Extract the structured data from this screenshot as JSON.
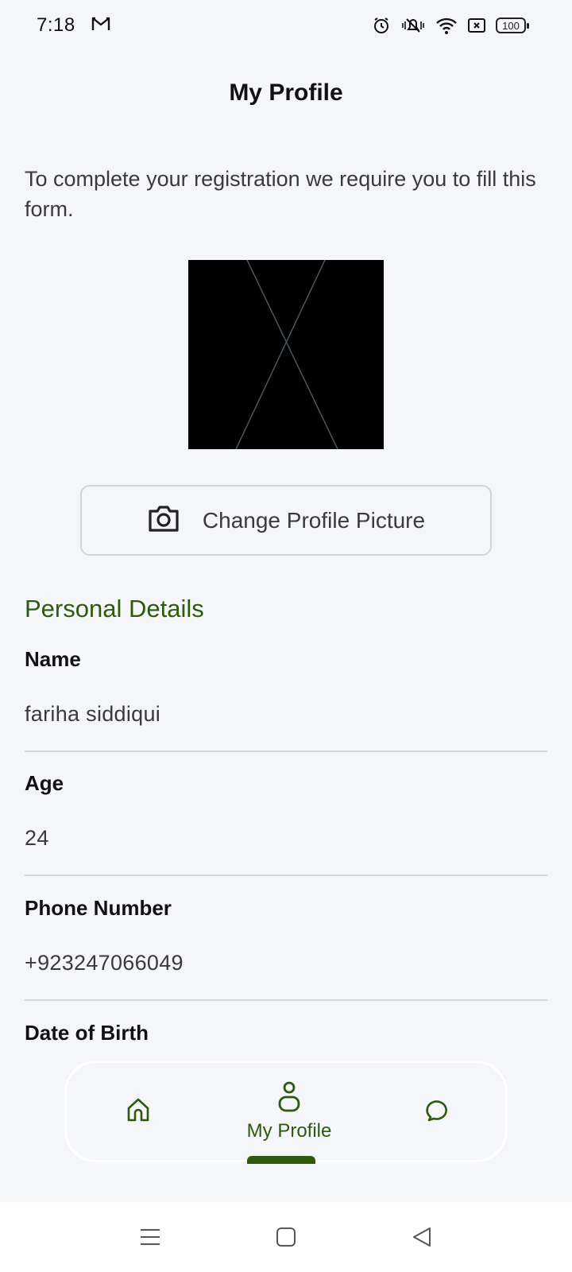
{
  "status_bar": {
    "time": "7:18",
    "battery": "100"
  },
  "header": {
    "title": "My Profile"
  },
  "intro_text": "To complete your registration we require you to fill this form.",
  "change_picture_label": "Change Profile Picture",
  "section_title": "Personal Details",
  "fields": [
    {
      "label": "Name",
      "value": "fariha siddiqui"
    },
    {
      "label": "Age",
      "value": "24"
    },
    {
      "label": "Phone Number",
      "value": "+923247066049"
    },
    {
      "label": "Date of Birth",
      "value": ""
    }
  ],
  "bottom_nav": {
    "items": [
      {
        "icon": "home-icon",
        "label": ""
      },
      {
        "icon": "user-icon",
        "label": "My Profile"
      },
      {
        "icon": "chat-icon",
        "label": ""
      }
    ]
  },
  "colors": {
    "accent": "#2d5a0d",
    "background": "#f5f6fa"
  }
}
